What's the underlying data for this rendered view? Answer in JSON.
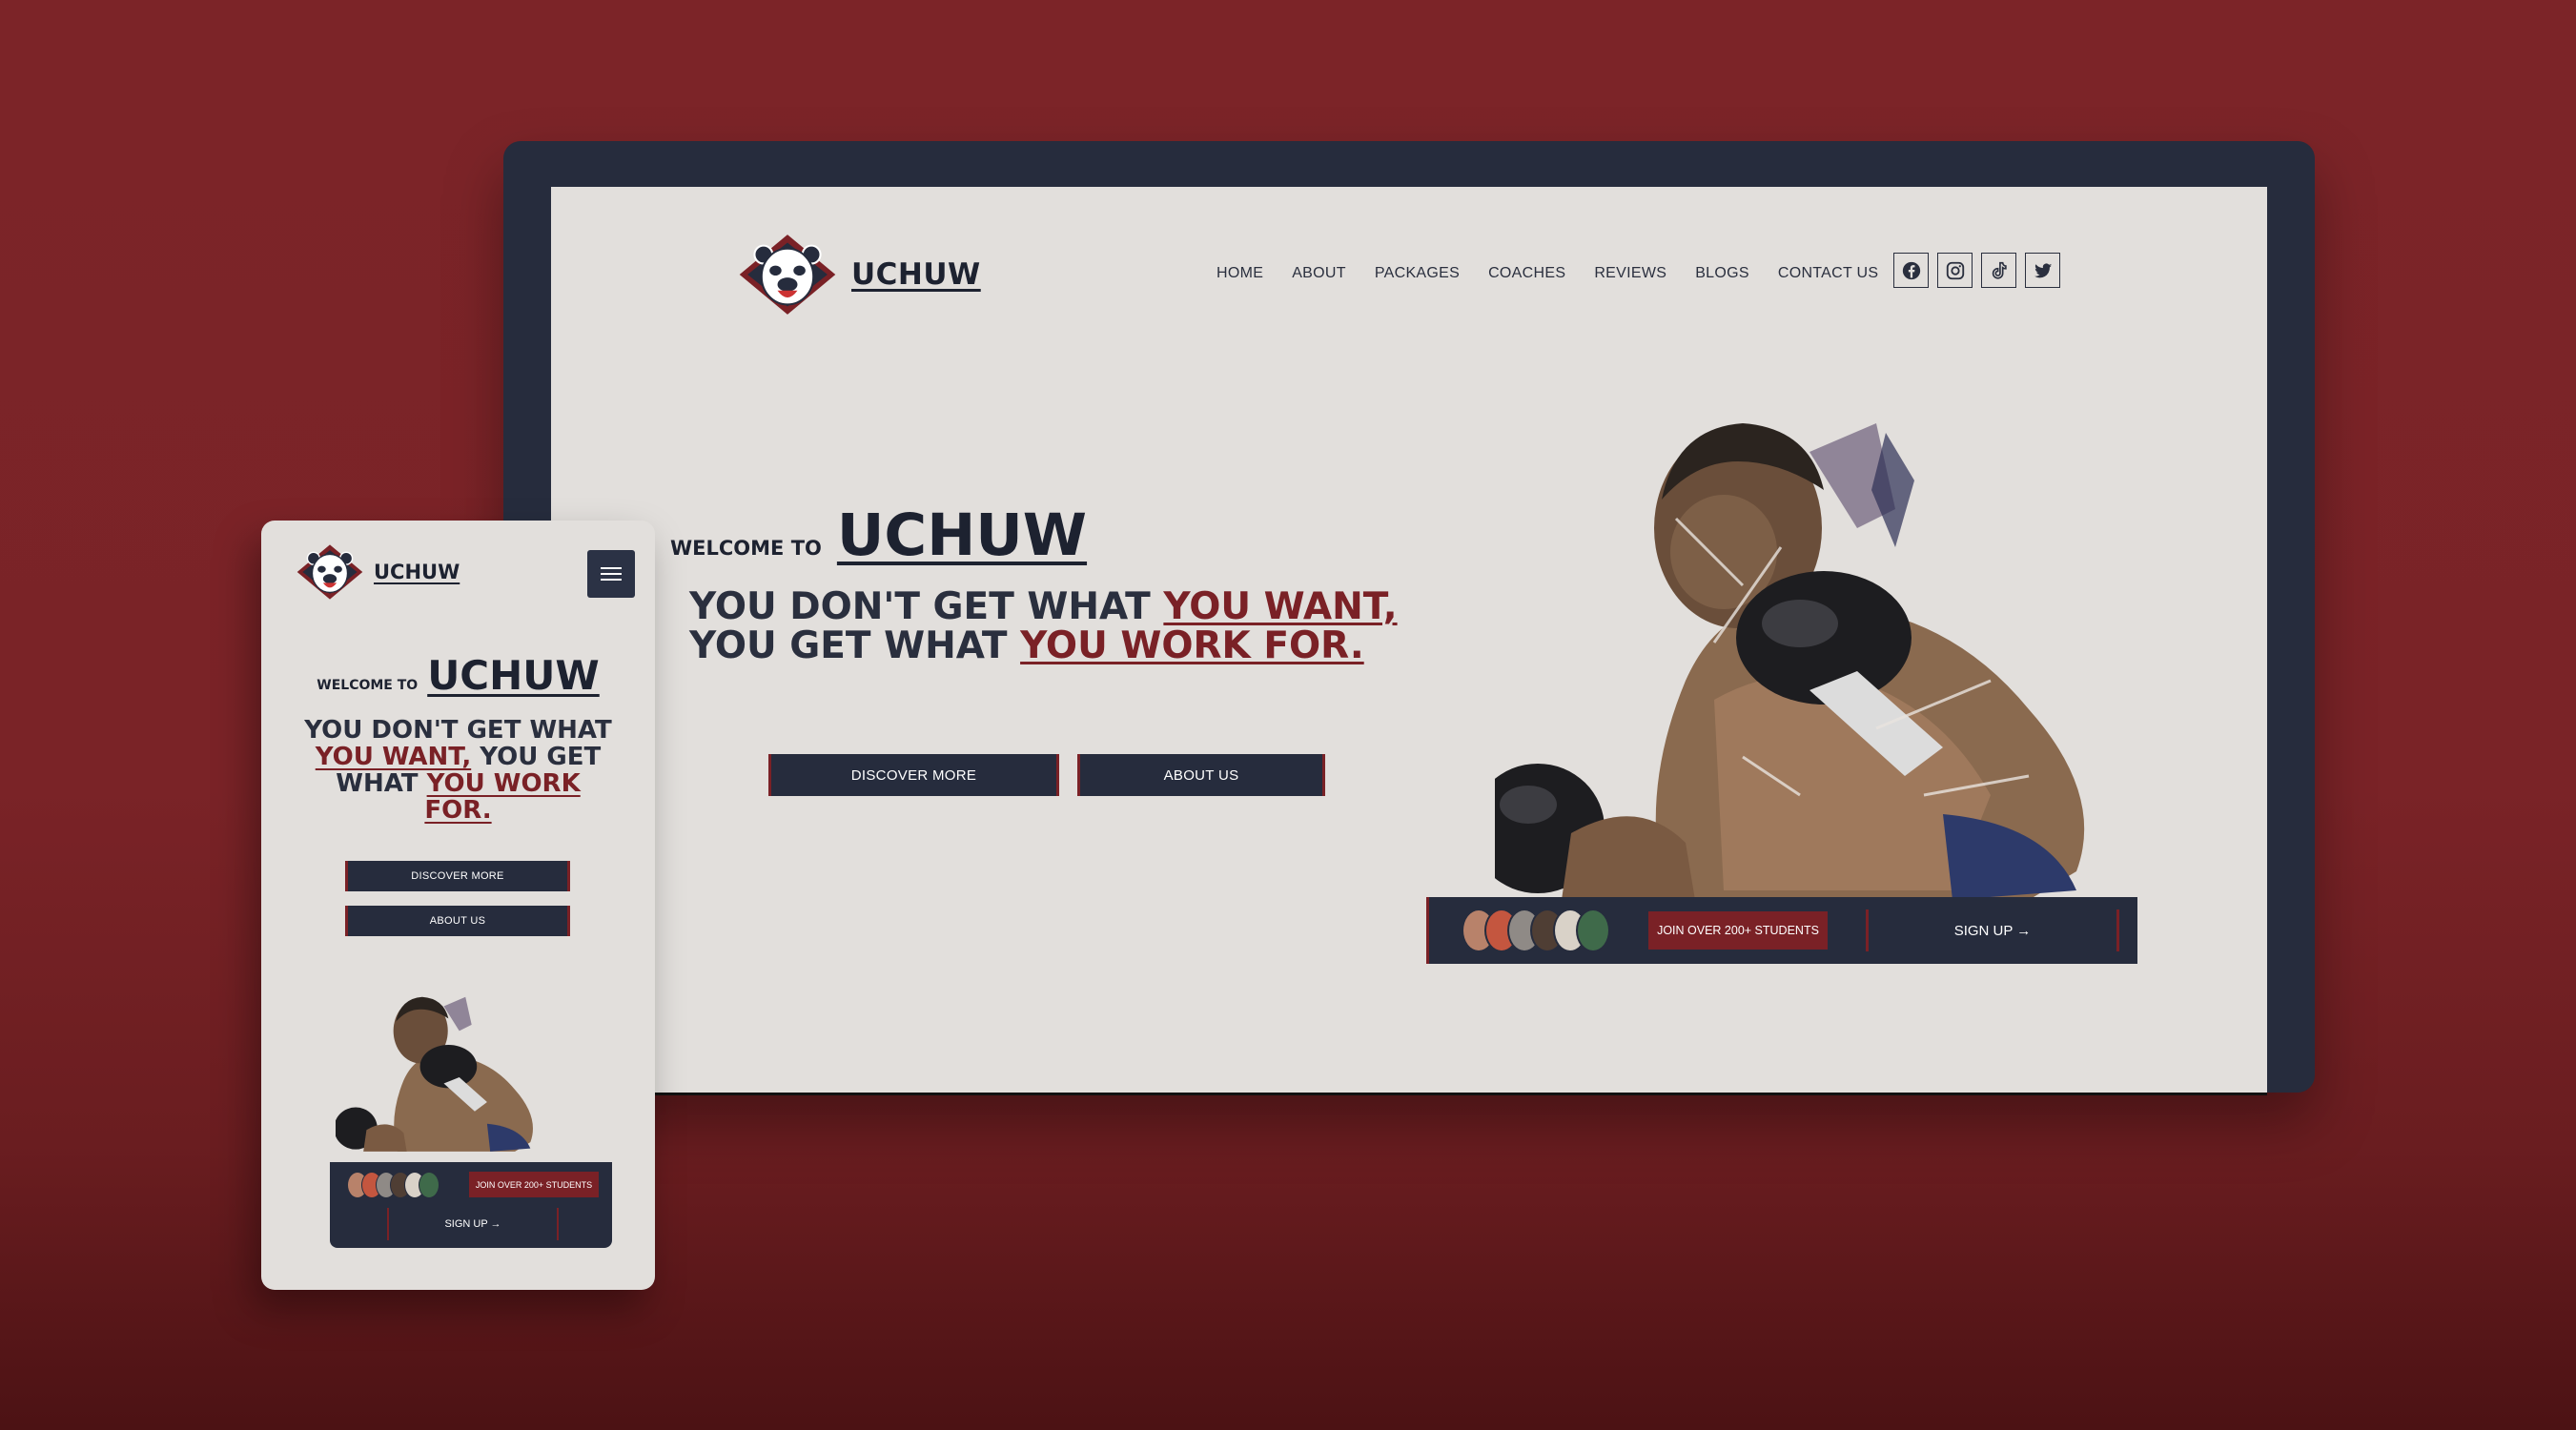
{
  "brand": {
    "name": "UCHUW"
  },
  "nav": {
    "items": [
      "HOME",
      "ABOUT",
      "PACKAGES",
      "COACHES",
      "REVIEWS",
      "BLOGS",
      "CONTACT US"
    ]
  },
  "social": [
    "facebook-icon",
    "instagram-icon",
    "tiktok-icon",
    "twitter-icon"
  ],
  "hero": {
    "welcome_small": "WELCOME TO",
    "welcome_big": "UCHUW",
    "headline_part1": "YOU DON'T GET WHAT ",
    "headline_highlight1": "YOU WANT,",
    "headline_part2": " YOU GET WHAT ",
    "headline_highlight2": "YOU WORK FOR.",
    "discover_label": "DISCOVER MORE",
    "about_label": "ABOUT US"
  },
  "cta": {
    "join_label": "JOIN OVER 200+ STUDENTS",
    "signup_label": "SIGN UP →"
  },
  "mobile": {
    "menu_icon": "hamburger-icon"
  },
  "colors": {
    "page_bg": "#7c2428",
    "navy": "#262c3d",
    "accent_red": "#7a2126",
    "screen_bg": "#e2dfdc"
  }
}
